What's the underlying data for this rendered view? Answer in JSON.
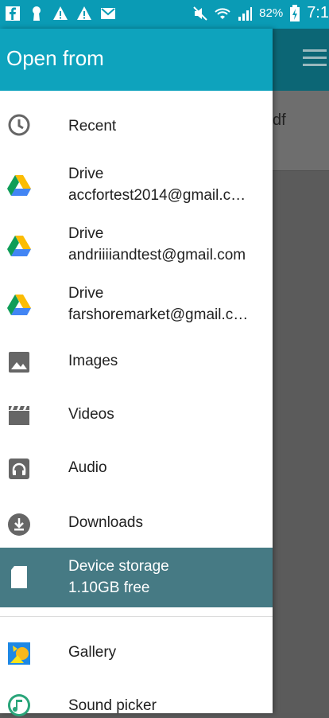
{
  "status_bar": {
    "battery": "82%",
    "time": "7:1"
  },
  "background": {
    "partial_text": "df"
  },
  "drawer": {
    "title": "Open from",
    "items": [
      {
        "label": "Recent",
        "icon": "clock-icon"
      },
      {
        "label": "Drive",
        "sub": "accfortest2014@gmail.c…",
        "icon": "google-drive-icon"
      },
      {
        "label": "Drive",
        "sub": "andriiiiandtest@gmail.com",
        "icon": "google-drive-icon"
      },
      {
        "label": "Drive",
        "sub": "farshoremarket@gmail.c…",
        "icon": "google-drive-icon"
      },
      {
        "label": "Images",
        "icon": "image-icon"
      },
      {
        "label": "Videos",
        "icon": "video-icon"
      },
      {
        "label": "Audio",
        "icon": "audio-icon"
      },
      {
        "label": "Downloads",
        "icon": "download-icon"
      },
      {
        "label": "Device storage",
        "sub": "1.10GB free",
        "icon": "sd-card-icon",
        "selected": true
      },
      {
        "label": "Gallery",
        "icon": "gallery-icon"
      },
      {
        "label": "Sound picker",
        "icon": "sound-picker-icon"
      }
    ]
  },
  "colors": {
    "header": "#0ea3bd",
    "statusbar": "#0a9bb5",
    "selected": "#467a84"
  }
}
